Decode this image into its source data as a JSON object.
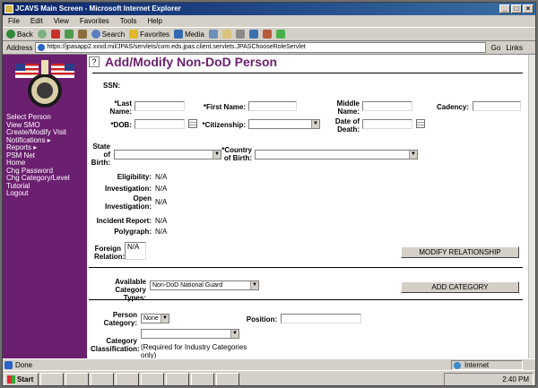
{
  "window": {
    "title": "JCAVS Main Screen - Microsoft Internet Explorer"
  },
  "menu": [
    "File",
    "Edit",
    "View",
    "Favorites",
    "Tools",
    "Help"
  ],
  "toolbar": {
    "back": "Back",
    "search": "Search",
    "favorites": "Favorites",
    "media": "Media"
  },
  "address": {
    "label": "Address",
    "url": "https://jpasapp2.xxxd.mil/JPAS/servlets/com.eds.jpas.client.servlets.JPASChooseRoleServlet",
    "go": "Go",
    "links": "Links"
  },
  "sidebar": {
    "items": [
      "Select Person",
      "View SMO",
      "Create/Modify Visit",
      "Notifications ▸",
      "Reports ▸",
      "PSM Net",
      "Home",
      "Chg Password",
      "Chg Category/Level",
      "Tutorial",
      "Logout"
    ]
  },
  "page": {
    "help": "?",
    "title": "Add/Modify Non-DoD Person"
  },
  "form": {
    "ssn_label": "SSN:",
    "last_name_label": "*Last Name:",
    "first_name_label": "*First Name:",
    "middle_name_label": "Middle Name:",
    "cadency_label": "Cadency:",
    "dob_label": "*DOB:",
    "citizenship_label": "*Citizenship:",
    "date_of_death_label": "Date of Death:",
    "state_of_birth_label": "State of Birth:",
    "country_of_birth_label": "*Country of Birth:",
    "eligibility_label": "Eligibility:",
    "eligibility_value": "N/A",
    "investigation_label": "Investigation:",
    "investigation_value": "N/A",
    "open_investigation_label": "Open Investigation:",
    "open_investigation_value": "N/A",
    "incident_report_label": "Incident Report:",
    "incident_report_value": "N/A",
    "polygraph_label": "Polygraph:",
    "polygraph_value": "N/A",
    "foreign_relation_label": "Foreign Relation:",
    "foreign_relation_value": "N/A",
    "modify_relationship_button": "MODIFY RELATIONSHIP",
    "available_category_types_label": "Available Category Types:",
    "available_category_types_value": "Non-DoD National Guard",
    "add_category_button": "ADD CATEGORY",
    "person_category_label": "Person Category:",
    "person_category_value": "None",
    "position_label": "Position:",
    "category_classification_label": "Category Classification:",
    "category_classification_note": "(Required for Industry Categories only)"
  },
  "status": {
    "text": "Done",
    "zone": "Internet"
  },
  "taskbar": {
    "start": "Start",
    "clock": "2:40 PM"
  }
}
